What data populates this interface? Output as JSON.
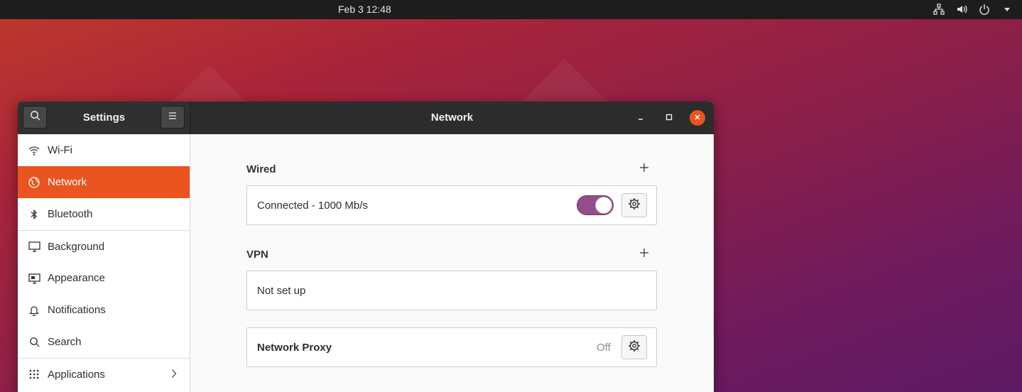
{
  "topbar": {
    "clock": "Feb 3  12:48",
    "tray_icons": [
      "network-icon",
      "volume-icon",
      "power-icon",
      "caret-down-icon"
    ]
  },
  "window": {
    "sidebar_title": "Settings",
    "page_title": "Network"
  },
  "sidebar": {
    "items": [
      {
        "label": "Wi-Fi",
        "icon": "wifi-icon",
        "active": false
      },
      {
        "label": "Network",
        "icon": "globe-icon",
        "active": true
      },
      {
        "label": "Bluetooth",
        "icon": "bluetooth-icon",
        "active": false
      },
      {
        "label": "Background",
        "icon": "monitor-icon",
        "active": false
      },
      {
        "label": "Appearance",
        "icon": "appearance-icon",
        "active": false
      },
      {
        "label": "Notifications",
        "icon": "bell-icon",
        "active": false
      },
      {
        "label": "Search",
        "icon": "search-icon",
        "active": false
      },
      {
        "label": "Applications",
        "icon": "grid-icon",
        "active": false
      }
    ]
  },
  "wired": {
    "heading": "Wired",
    "status": "Connected - 1000 Mb/s",
    "enabled": true
  },
  "vpn": {
    "heading": "VPN",
    "status": "Not set up"
  },
  "proxy": {
    "label": "Network Proxy",
    "state": "Off"
  },
  "colors": {
    "accent": "#e95420",
    "toggle_on": "#924d8b",
    "titlebar": "#2c2c2c"
  }
}
